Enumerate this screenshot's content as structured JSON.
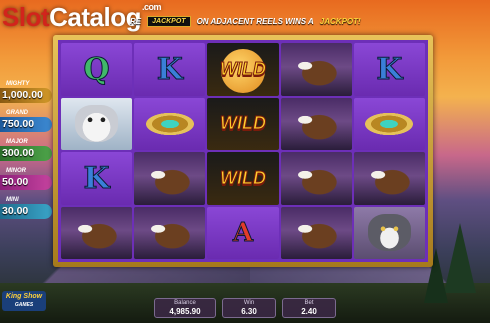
{
  "logo": {
    "slot": "Slot",
    "catalog": "Catalog",
    "com": ".com"
  },
  "banner": {
    "prefix": "RE",
    "jackpot_badge": "JACKPOT",
    "text": "ON ADJACENT REELS WINS A",
    "highlight": "JACKPOT!"
  },
  "jackpots": [
    {
      "name": "MIGHTY",
      "value": "1,000.00"
    },
    {
      "name": "GRAND",
      "value": "750.00"
    },
    {
      "name": "MAJOR",
      "value": "300.00"
    },
    {
      "name": "MINOR",
      "value": "50.00"
    },
    {
      "name": "MINI",
      "value": "30.00"
    }
  ],
  "reels": {
    "row1": [
      "Q",
      "K",
      "WILD",
      "eagle",
      "K"
    ],
    "row2": [
      "white-wolf",
      "amulet",
      "WILD",
      "eagle",
      "amulet"
    ],
    "row3": [
      "K",
      "eagle",
      "WILD",
      "eagle",
      "eagle"
    ],
    "row4": [
      "eagle",
      "eagle",
      "A",
      "eagle",
      "grey-wolf"
    ],
    "wild_label": "WILD"
  },
  "provider": {
    "name": "King Show",
    "sub": "GAMES"
  },
  "meters": {
    "balance_label": "Balance",
    "balance": "4,985.90",
    "win_label": "Win",
    "win": "6.30",
    "bet_label": "Bet",
    "bet": "2.40"
  },
  "colors": {
    "reel_bg": "#6d2fb8",
    "frame_gold": "#e8c35a",
    "wild_gold": "#ffcf2e",
    "logo_red": "#d2241c"
  }
}
